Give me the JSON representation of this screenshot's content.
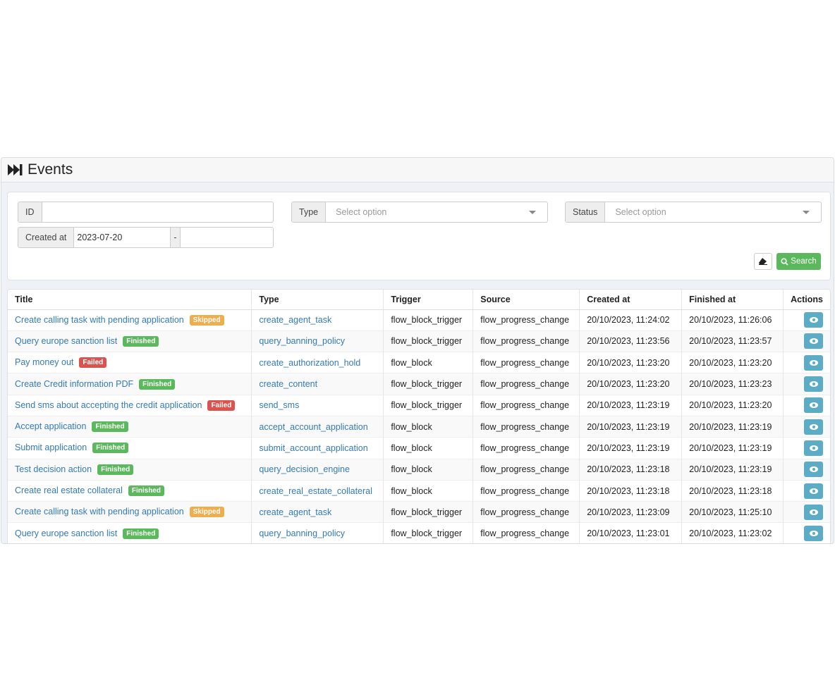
{
  "header": {
    "title": "Events",
    "icon": "fast-forward-icon"
  },
  "filters": {
    "id_label": "ID",
    "id_value": "",
    "type_label": "Type",
    "type_placeholder": "Select option",
    "status_label": "Status",
    "status_placeholder": "Select option",
    "created_label": "Created at",
    "created_from": "2023-07-20",
    "created_sep": "-",
    "created_to": "",
    "search_label": "Search"
  },
  "colors": {
    "finished": "#5cb85c",
    "failed": "#d9534f",
    "skipped": "#f0ad4e",
    "link": "#337ab7",
    "action": "#5bacc4"
  },
  "table": {
    "columns": [
      "Title",
      "Type",
      "Trigger",
      "Source",
      "Created at",
      "Finished at",
      "Actions"
    ],
    "rows": [
      {
        "title": "Create calling task with pending application",
        "status": "Skipped",
        "type": "create_agent_task",
        "trigger": "flow_block_trigger",
        "source": "flow_progress_change",
        "created": "20/10/2023, 11:24:02",
        "finished": "20/10/2023, 11:26:06"
      },
      {
        "title": "Query europe sanction list",
        "status": "Finished",
        "type": "query_banning_policy",
        "trigger": "flow_block_trigger",
        "source": "flow_progress_change",
        "created": "20/10/2023, 11:23:56",
        "finished": "20/10/2023, 11:23:57"
      },
      {
        "title": "Pay money out",
        "status": "Failed",
        "type": "create_authorization_hold",
        "trigger": "flow_block",
        "source": "flow_progress_change",
        "created": "20/10/2023, 11:23:20",
        "finished": "20/10/2023, 11:23:20"
      },
      {
        "title": "Create Credit information PDF",
        "status": "Finished",
        "type": "create_content",
        "trigger": "flow_block_trigger",
        "source": "flow_progress_change",
        "created": "20/10/2023, 11:23:20",
        "finished": "20/10/2023, 11:23:23"
      },
      {
        "title": "Send sms about accepting the credit application",
        "status": "Failed",
        "type": "send_sms",
        "trigger": "flow_block_trigger",
        "source": "flow_progress_change",
        "created": "20/10/2023, 11:23:19",
        "finished": "20/10/2023, 11:23:20"
      },
      {
        "title": "Accept application",
        "status": "Finished",
        "type": "accept_account_application",
        "trigger": "flow_block",
        "source": "flow_progress_change",
        "created": "20/10/2023, 11:23:19",
        "finished": "20/10/2023, 11:23:19"
      },
      {
        "title": "Submit application",
        "status": "Finished",
        "type": "submit_account_application",
        "trigger": "flow_block",
        "source": "flow_progress_change",
        "created": "20/10/2023, 11:23:19",
        "finished": "20/10/2023, 11:23:19"
      },
      {
        "title": "Test decision action",
        "status": "Finished",
        "type": "query_decision_engine",
        "trigger": "flow_block",
        "source": "flow_progress_change",
        "created": "20/10/2023, 11:23:18",
        "finished": "20/10/2023, 11:23:19"
      },
      {
        "title": "Create real estate collateral",
        "status": "Finished",
        "type": "create_real_estate_collateral",
        "trigger": "flow_block",
        "source": "flow_progress_change",
        "created": "20/10/2023, 11:23:18",
        "finished": "20/10/2023, 11:23:18"
      },
      {
        "title": "Create calling task with pending application",
        "status": "Skipped",
        "type": "create_agent_task",
        "trigger": "flow_block_trigger",
        "source": "flow_progress_change",
        "created": "20/10/2023, 11:23:09",
        "finished": "20/10/2023, 11:25:10"
      },
      {
        "title": "Query europe sanction list",
        "status": "Finished",
        "type": "query_banning_policy",
        "trigger": "flow_block_trigger",
        "source": "flow_progress_change",
        "created": "20/10/2023, 11:23:01",
        "finished": "20/10/2023, 11:23:02"
      }
    ]
  }
}
